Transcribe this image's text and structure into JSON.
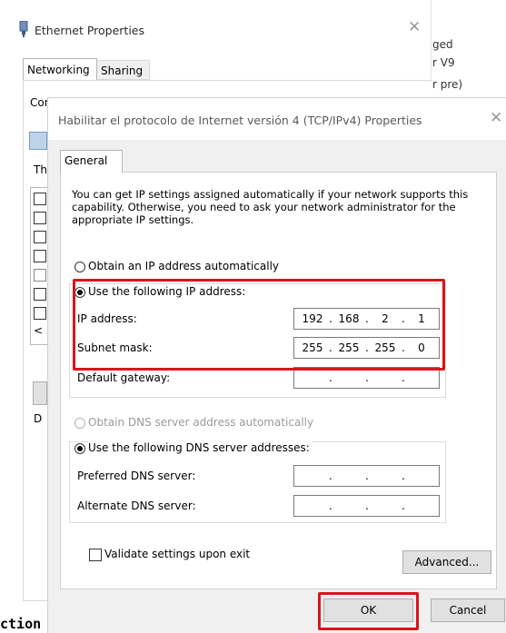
{
  "ethernet_window": {
    "title": "Ethernet Properties",
    "tabs": [
      "Networking",
      "Sharing"
    ],
    "connect_using_label": "Connect using:",
    "this_connection_label": "Th",
    "bottom_left_label": "D"
  },
  "right_edge_text": [
    "ged",
    "r V9",
    "r pre)"
  ],
  "ipv4_dialog": {
    "title": "Habilitar el protocolo de Internet versión 4 (TCP/IPv4) Properties",
    "tab": "General",
    "description": "You can get IP settings assigned automatically if your network supports this capability. Otherwise, you need to ask your network administrator for the appropriate IP settings.",
    "ip_options": {
      "auto_label": "Obtain an IP address automatically",
      "manual_label": "Use the following IP address:",
      "selected": "manual"
    },
    "ip_fields": {
      "ip_address_label": "IP address:",
      "ip_address": [
        "192",
        "168",
        "2",
        "1"
      ],
      "subnet_mask_label": "Subnet mask:",
      "subnet_mask": [
        "255",
        "255",
        "255",
        "0"
      ],
      "gateway_label": "Default gateway:",
      "gateway": [
        "",
        "",
        "",
        ""
      ]
    },
    "dns_options": {
      "auto_label": "Obtain DNS server address automatically",
      "manual_label": "Use the following DNS server addresses:",
      "selected": "manual"
    },
    "dns_fields": {
      "preferred_label": "Preferred DNS server:",
      "alternate_label": "Alternate DNS server:"
    },
    "validate_label": "Validate settings upon exit",
    "advanced_label": "Advanced...",
    "ok_label": "OK",
    "cancel_label": "Cancel"
  },
  "bottom_partial_text": "ction",
  "colors": {
    "highlight_red": "#d9141e",
    "dialog_bg": "#f0f0f0",
    "button_bg": "#e1e1e1"
  }
}
